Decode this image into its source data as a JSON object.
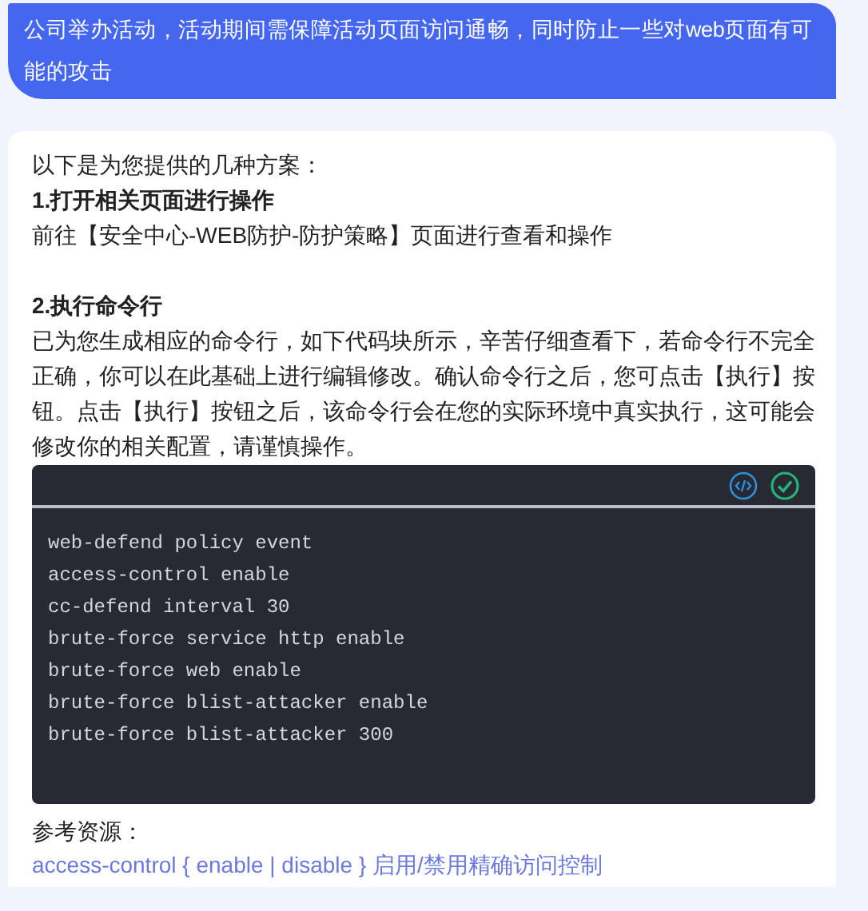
{
  "user_message": "公司举办活动，活动期间需保障活动页面访问通畅，同时防止一些对web页面有可能的攻击",
  "reply": {
    "intro": "以下是为您提供的几种方案：",
    "sections": [
      {
        "heading": "1.打开相关页面进行操作",
        "paragraphs": [
          "前往【安全中心-WEB防护-防护策略】页面进行查看和操作"
        ]
      },
      {
        "heading": "2.执行命令行",
        "paragraphs": [
          "已为您生成相应的命令行，如下代码块所示，辛苦仔细查看下，若命令行不完全正确，你可以在此基础上进行编辑修改。确认命令行之后，您可点击【执行】按钮。点击【执行】按钮之后，该命令行会在您的实际环境中真实执行，这可能会修改你的相关配置，请谨慎操作。"
        ],
        "code": {
          "lines": [
            "web-defend policy event",
            "access-control enable",
            "cc-defend interval 30",
            "brute-force service http enable",
            "brute-force web enable",
            "brute-force blist-attacker enable",
            "brute-force blist-attacker 300"
          ]
        }
      }
    ],
    "references_label": "参考资源：",
    "references": [
      "access-control { enable | disable } 启用/禁用精确访问控制"
    ]
  }
}
